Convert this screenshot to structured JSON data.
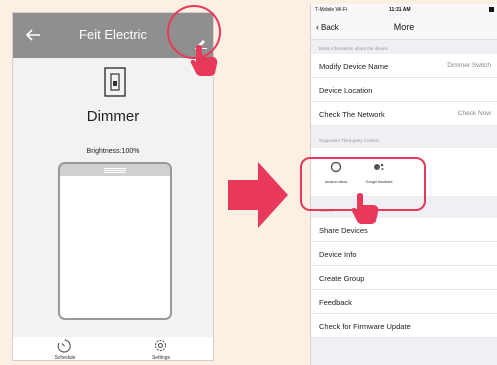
{
  "colors": {
    "accent": "#e8395b",
    "header_gray": "#8f8f8f"
  },
  "left_screen": {
    "header": {
      "title": "Feit Electric",
      "back_icon": "arrow-left-icon",
      "edit_icon": "pencil-icon"
    },
    "device_name": "Dimmer",
    "brightness_label": "Brightness:100%",
    "brightness_level": 1.0,
    "footer": {
      "schedule_label": "Schedule",
      "settings_label": "Settings"
    }
  },
  "right_screen": {
    "status_bar": {
      "carrier": "T-Mobile Wi-Fi",
      "time": "11:31 AM"
    },
    "nav": {
      "back_label": "Back",
      "title": "More"
    },
    "section_basic": "Basic information about the device",
    "basic_rows": [
      {
        "label": "Modify Device Name",
        "value": "Dimmer Switch"
      },
      {
        "label": "Device Location",
        "value": ""
      },
      {
        "label": "Check The Network",
        "value": "Check Now"
      }
    ],
    "section_third": "Supported Third-party Control",
    "third_party": {
      "alexa": "amazon alexa",
      "google": "Google Assistant"
    },
    "section_others": "Others",
    "other_rows": [
      "Share Devices",
      "Device Info",
      "Create Group",
      "Feedback",
      "Check for Firmware Update"
    ]
  }
}
